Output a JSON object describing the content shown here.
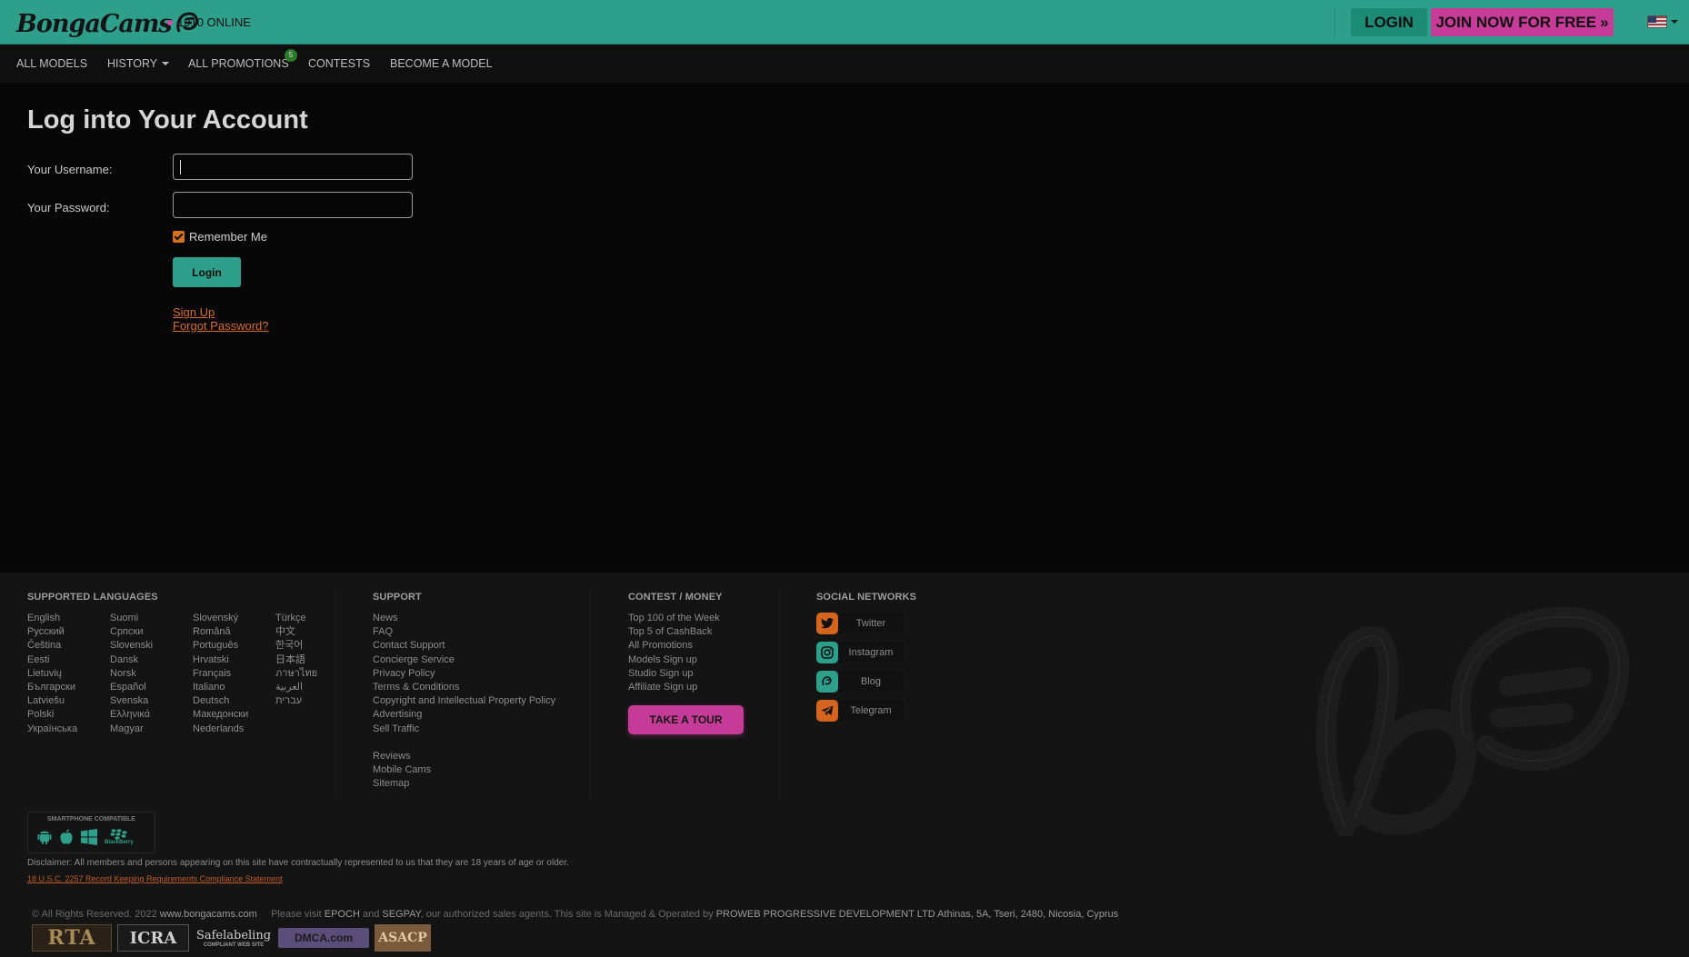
{
  "header": {
    "logo_text": "BongaCams",
    "online_text": "1910 ONLINE",
    "login_label": "LOGIN",
    "join_label": "JOIN NOW FOR FREE",
    "join_arrow": "»"
  },
  "nav": {
    "items": [
      "ALL MODELS",
      "HISTORY",
      "ALL PROMOTIONS",
      "CONTESTS",
      "BECOME A MODEL"
    ],
    "promotions_badge": "5"
  },
  "login_form": {
    "title": "Log into Your Account",
    "username_label": "Your Username:",
    "password_label": "Your Password:",
    "remember_label": "Remember Me",
    "remember_checked": true,
    "submit_label": "Login",
    "signup_link": "Sign Up",
    "forgot_link": "Forgot Password?"
  },
  "footer": {
    "languages_title": "SUPPORTED LANGUAGES",
    "languages": [
      [
        "English",
        "Русский",
        "Čeština",
        "Eesti",
        "Lietuvių",
        "Български",
        "Latviešu",
        "Polski",
        "Українська"
      ],
      [
        "Suomi",
        "Српски",
        "Slovenski",
        "Dansk",
        "Norsk",
        "Español",
        "Svenska",
        "Ελληνικά",
        "Magyar"
      ],
      [
        "Slovenský",
        "Română",
        "Português",
        "Hrvatski",
        "Français",
        "Italiano",
        "Deutsch",
        "Македонски",
        "Nederlands"
      ],
      [
        "Türkçe",
        "中文",
        "한국어",
        "日本語",
        "ภาษาไทย",
        "العربية",
        "עברית"
      ]
    ],
    "support_title": "SUPPORT",
    "support_links": [
      "News",
      "FAQ",
      "Contact Support",
      "Concierge Service",
      "Privacy Policy",
      "Terms & Conditions",
      "Copyright and Intellectual Property Policy",
      "Advertising",
      "Sell Traffic"
    ],
    "support_links_2": [
      "Reviews",
      "Mobile Cams",
      "Sitemap"
    ],
    "contest_title": "CONTEST / MONEY",
    "contest_links": [
      "Top 100 of the Week",
      "Top 5 of CashBack",
      "All Promotions",
      "Models Sign up",
      "Studio Sign up",
      "Affiliate Sign up"
    ],
    "tour_label": "TAKE A TOUR",
    "social_title": "SOCIAL NETWORKS",
    "social": [
      {
        "label": "Twitter",
        "icon": "twitter-icon",
        "color": "#d5651e"
      },
      {
        "label": "Instagram",
        "icon": "instagram-icon",
        "color": "#2a9f8a"
      },
      {
        "label": "Blog",
        "icon": "blog-icon",
        "color": "#2e9f8b"
      },
      {
        "label": "Telegram",
        "icon": "telegram-icon",
        "color": "#d5651e"
      }
    ],
    "smartphone_title": "SMARTPHONE COMPATIBLE",
    "blackberry_label": "BlackBerry",
    "disclaimer": "Disclaimer: All members and persons appearing on this site have contractually represented to us that they are 18 years of age or older.",
    "compliance_link": "18 U.S.C. 2257 Record Keeping Requirements Compliance Statement",
    "copyright_prefix": "© All Rights Reserved. 2022",
    "copyright_site": "www.bongacams.com",
    "visit_prefix": "Please visit",
    "visit_epoch": "EPOCH",
    "visit_and": "and",
    "visit_segpay": "SEGPAY",
    "visit_mid": ", our authorized sales agents. This site is Managed & Operated by",
    "operator": "PROWEB PROGRESSIVE DEVELOPMENT LTD Athinas, 5A, Tseri, 2480, Nicosia, Cyprus",
    "badges": [
      "RTA",
      "ICRA",
      "Safelabeling",
      "DMCA.com",
      "ASACP"
    ],
    "safelabeling_sub": "COMPLIANT WEB SITE"
  },
  "colors": {
    "accent_teal": "#2e9f8b",
    "accent_pink": "#c73b98",
    "accent_orange": "#d86a2b",
    "background": "#070707"
  }
}
